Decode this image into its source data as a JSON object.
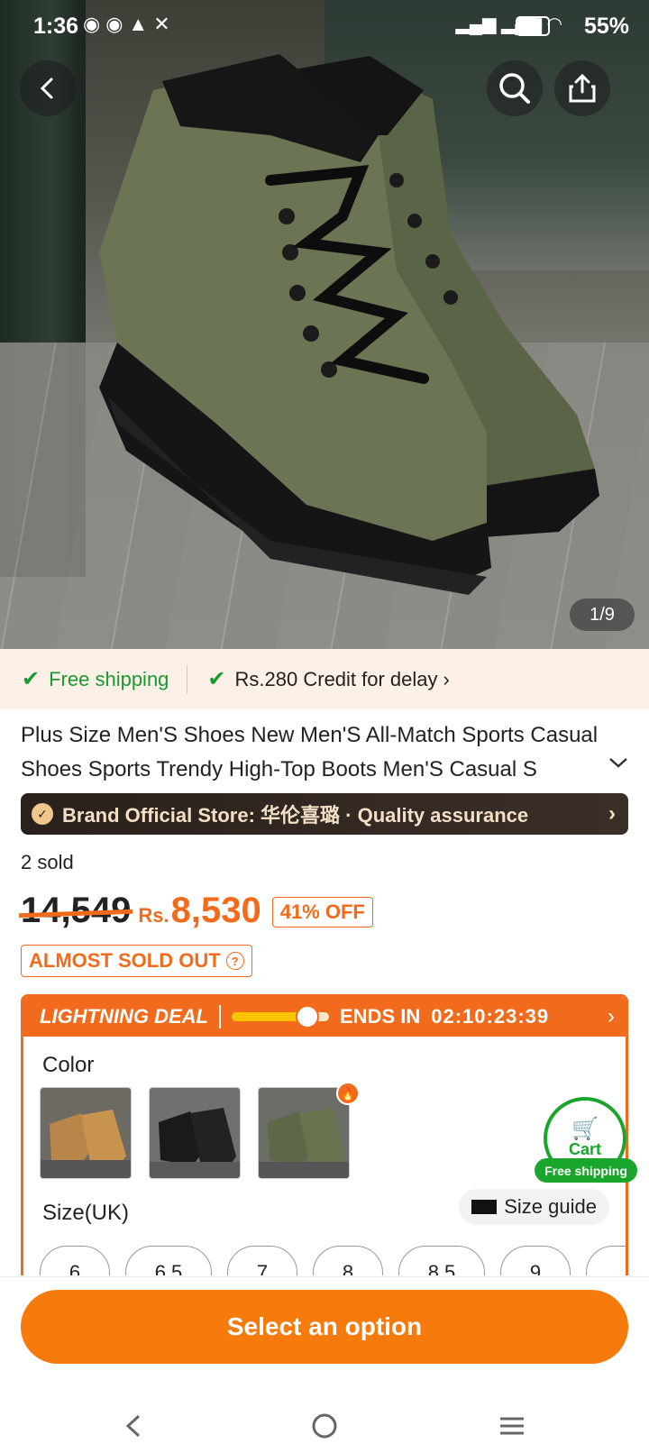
{
  "status": {
    "time": "1:36",
    "battery": "55%",
    "notif_icons": [
      "whatsapp-icon",
      "whatsapp-icon",
      "warning-icon",
      "x-icon"
    ],
    "net_icons": [
      "4g-signal-icon",
      "4g-signal-icon",
      "wifi-icon",
      "battery-icon"
    ]
  },
  "gallery": {
    "counter": "1/9",
    "icons": [
      "back-icon",
      "search-icon",
      "share-icon"
    ]
  },
  "shipping": {
    "free": "Free shipping",
    "credit": "Rs.280 Credit for delay"
  },
  "product": {
    "title_line1": "Plus Size Men'S Shoes New Men'S All-Match Sports Casual",
    "title_line2": "Shoes Sports Trendy High-Top Boots Men'S Casual S",
    "brand": "Brand Official Store: 华伦喜璐 · Quality assurance",
    "sold": "2 sold",
    "old_price": "14,549",
    "currency": "Rs.",
    "new_price": "8,530",
    "discount": "41% OFF",
    "almost": "ALMOST SOLD OUT"
  },
  "deal": {
    "label": "LIGHTNING DEAL",
    "ends_label": "ENDS IN",
    "timer": "02:10:23:39",
    "progress": 0.78
  },
  "options": {
    "color_label": "Color",
    "colors": [
      "tan",
      "black",
      "green"
    ],
    "size_label": "Size(UK)",
    "size_guide": "Size guide",
    "sizes": [
      "6",
      "6.5",
      "7",
      "8",
      "8.5",
      "9"
    ]
  },
  "cart": {
    "label": "Cart",
    "badge": "Free shipping"
  },
  "cta": "Select an option",
  "colors": {
    "accent": "#f26b1d",
    "green": "#1a9a32",
    "cta": "#f77a0c"
  }
}
